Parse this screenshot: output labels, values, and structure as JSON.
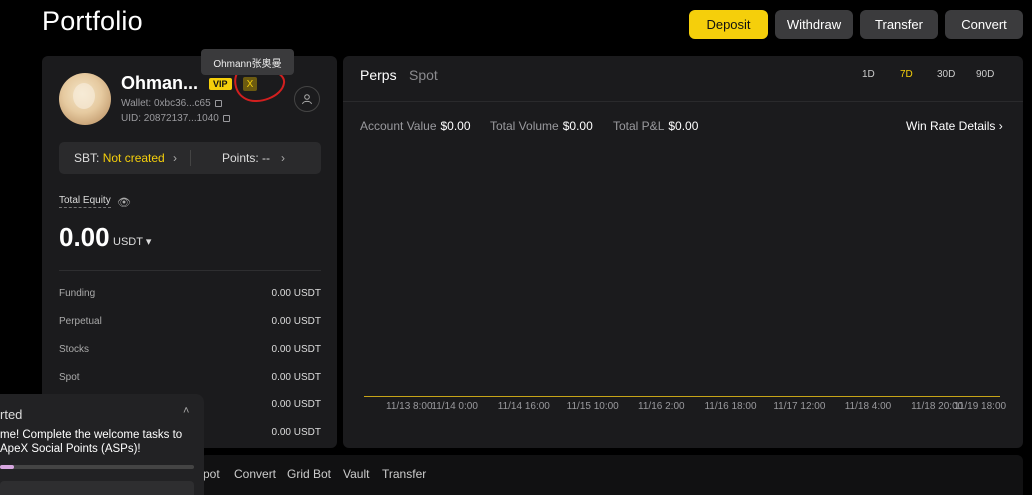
{
  "header": {
    "title": "Portfolio",
    "buttons": {
      "deposit": "Deposit",
      "withdraw": "Withdraw",
      "transfer": "Transfer",
      "convert": "Convert"
    }
  },
  "profile": {
    "tooltip": "Ohmann张奥曼",
    "name": "Ohman...",
    "vip": "VIP",
    "x_badge": "X",
    "wallet": "Wallet: 0xbc36...c65",
    "uid": "UID: 20872137...1040",
    "sbt_label": "SBT:",
    "sbt_value": "Not created",
    "points_label": "Points: --"
  },
  "equity": {
    "label": "Total Equity",
    "value": "0.00",
    "unit": "USDT"
  },
  "balances": [
    {
      "name": "Funding",
      "amount": "0.00 USDT"
    },
    {
      "name": "Perpetual",
      "amount": "0.00 USDT"
    },
    {
      "name": "Stocks",
      "amount": "0.00 USDT"
    },
    {
      "name": "Spot",
      "amount": "0.00 USDT"
    },
    {
      "name": "",
      "amount": "0.00 USDT"
    },
    {
      "name": "",
      "amount": "0.00 USDT"
    }
  ],
  "perf": {
    "tabs": [
      "Perps",
      "Spot"
    ],
    "ranges": [
      "1D",
      "7D",
      "30D",
      "90D"
    ],
    "active_range": "7D",
    "stats": {
      "account_value_label": "Account Value",
      "account_value": "$0.00",
      "total_volume_label": "Total Volume",
      "total_volume": "$0.00",
      "pnl_label": "Total P&L",
      "pnl": "$0.00"
    },
    "win_rate": "Win Rate Details"
  },
  "chart_data": {
    "type": "line",
    "x": [
      "11/13 8:00",
      "11/14 0:00",
      "11/14 16:00",
      "11/15 10:00",
      "11/16 2:00",
      "11/16 18:00",
      "11/17 12:00",
      "11/18 4:00",
      "11/18 20:00",
      "11/19 18:00"
    ],
    "series": [
      {
        "values": [
          0,
          0,
          0,
          0,
          0,
          0,
          0,
          0,
          0,
          0
        ]
      }
    ],
    "title": "",
    "xlabel": "",
    "ylabel": "",
    "color": "#c7a418",
    "grid": false
  },
  "onboarding": {
    "title": "rted",
    "text_line1": "me! Complete the welcome tasks to",
    "text_line2": "ApeX Social Points (ASPs)!",
    "progress": 0.07
  },
  "bottom_tabs": [
    "pot",
    "Convert",
    "Grid Bot",
    "Vault",
    "Transfer"
  ],
  "colors": {
    "accent": "#f5cf0b",
    "panel": "#1b1b1d",
    "background": "#000000"
  }
}
